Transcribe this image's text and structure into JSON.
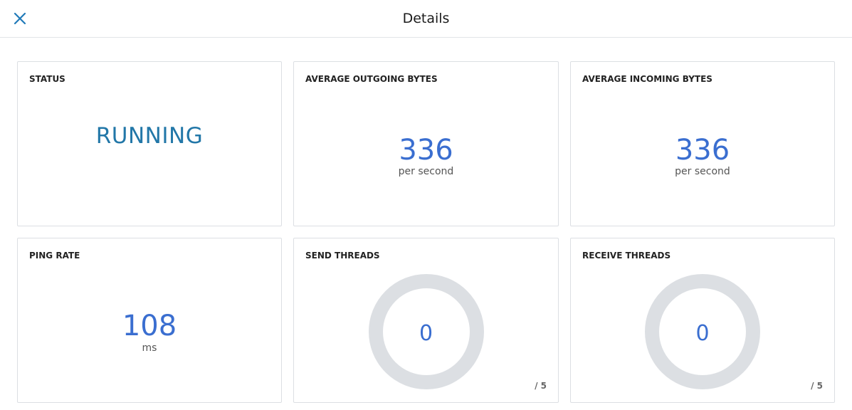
{
  "header": {
    "title": "Details",
    "close_icon": "close-icon"
  },
  "colors": {
    "accent_blue": "#3a6ed0",
    "status_blue": "#2277a8",
    "gauge_track": "#dcdfe3"
  },
  "cards": {
    "status": {
      "title": "STATUS",
      "value": "RUNNING"
    },
    "avg_outgoing": {
      "title": "AVERAGE OUTGOING BYTES",
      "value": "336",
      "unit": "per second"
    },
    "avg_incoming": {
      "title": "AVERAGE INCOMING BYTES",
      "value": "336",
      "unit": "per second"
    },
    "ping_rate": {
      "title": "PING RATE",
      "value": "108",
      "unit": "ms"
    },
    "send_threads": {
      "title": "SEND THREADS",
      "value": "0",
      "max_label": "/ 5",
      "fraction": 0
    },
    "receive_threads": {
      "title": "RECEIVE THREADS",
      "value": "0",
      "max_label": "/ 5",
      "fraction": 0
    }
  }
}
